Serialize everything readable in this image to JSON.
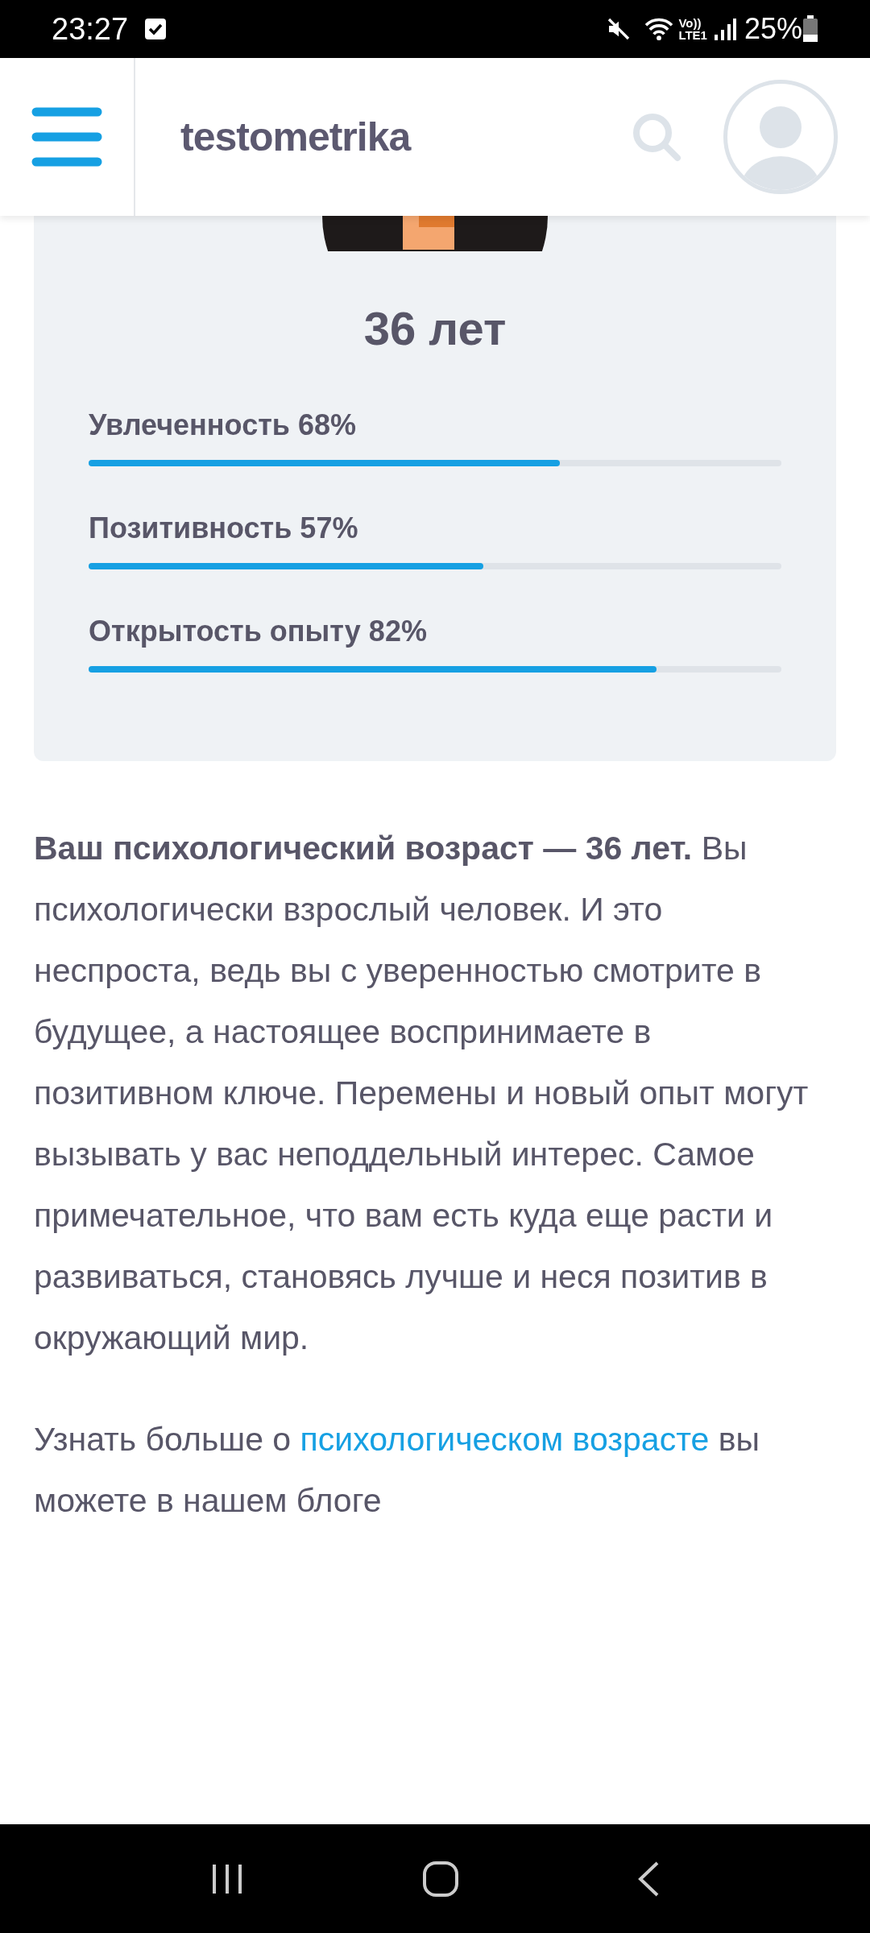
{
  "status_bar": {
    "time": "23:27",
    "network": "Vo)) LTE1",
    "battery": "25%"
  },
  "header": {
    "logo": "testometrika"
  },
  "result": {
    "age": "36 лет",
    "traits": [
      {
        "label": "Увлеченность 68%",
        "level": 0.68
      },
      {
        "label": "Позитивность 57%",
        "level": 0.57
      },
      {
        "label": "Открытость опыту 82%",
        "level": 0.82
      }
    ]
  },
  "description": "**Ваш психологический возраст — 36 лет.** Вы психологически взрослый человек. И это неспроста, ведь вы с уверенностью смотрите в будущее, а настоящее воспринимаете в позитивном ключе. Перемены и новый опыт могут вызывать у вас неподдельный интерес. Самое примечательное, что вам есть куда еще расти и развиваться, становясь лучше и неся позитив в окружающий мир.",
  "more": {
    "before": "Узнать больше о",
    "link": "психологическом возрасте",
    "after": "вы можете в нашем блоге"
  }
}
